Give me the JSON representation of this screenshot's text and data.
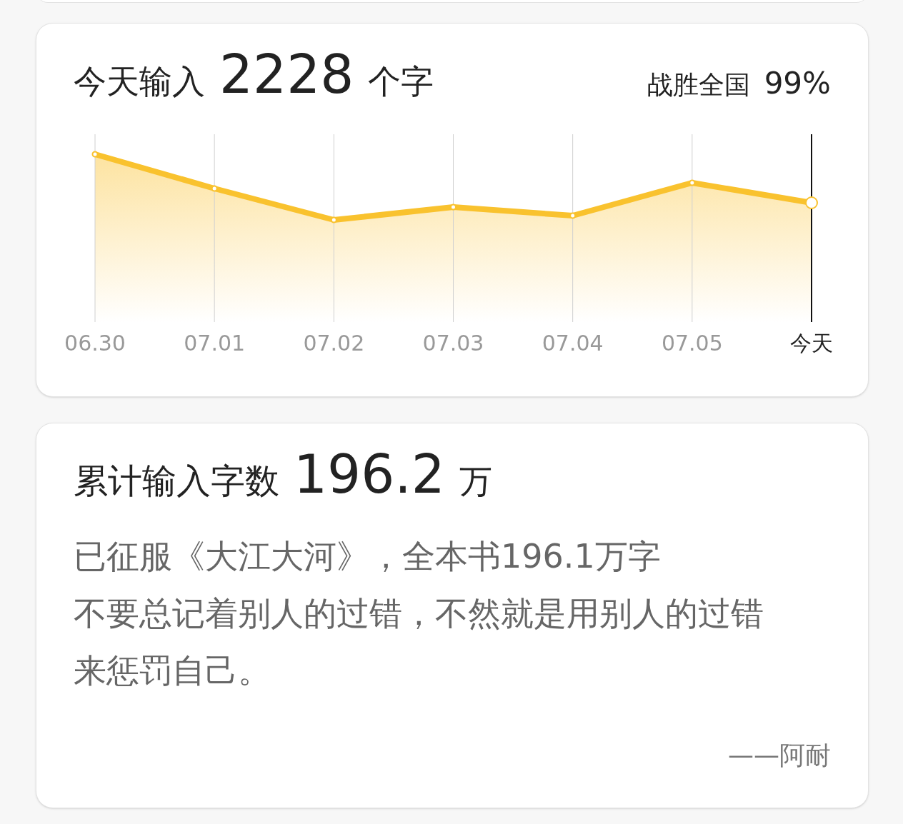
{
  "today_card": {
    "label": "今天输入",
    "count": "2228",
    "unit": "个字",
    "rank_label": "战胜全国",
    "rank_value": "99%",
    "x_labels": [
      {
        "text": "06.30",
        "selected": false
      },
      {
        "text": "07.01",
        "selected": false
      },
      {
        "text": "07.02",
        "selected": false
      },
      {
        "text": "07.03",
        "selected": false
      },
      {
        "text": "07.04",
        "selected": false
      },
      {
        "text": "07.05",
        "selected": false
      },
      {
        "text": "今天",
        "selected": true
      }
    ]
  },
  "total_card": {
    "label": "累计输入字数",
    "count": "196.2",
    "unit": "万",
    "lines": [
      "已征服《大江大河》，全本书196.1万字",
      "不要总记着别人的过错，不然就是用别人的过错来惩罚自己。"
    ],
    "attribution": "——阿耐"
  }
}
